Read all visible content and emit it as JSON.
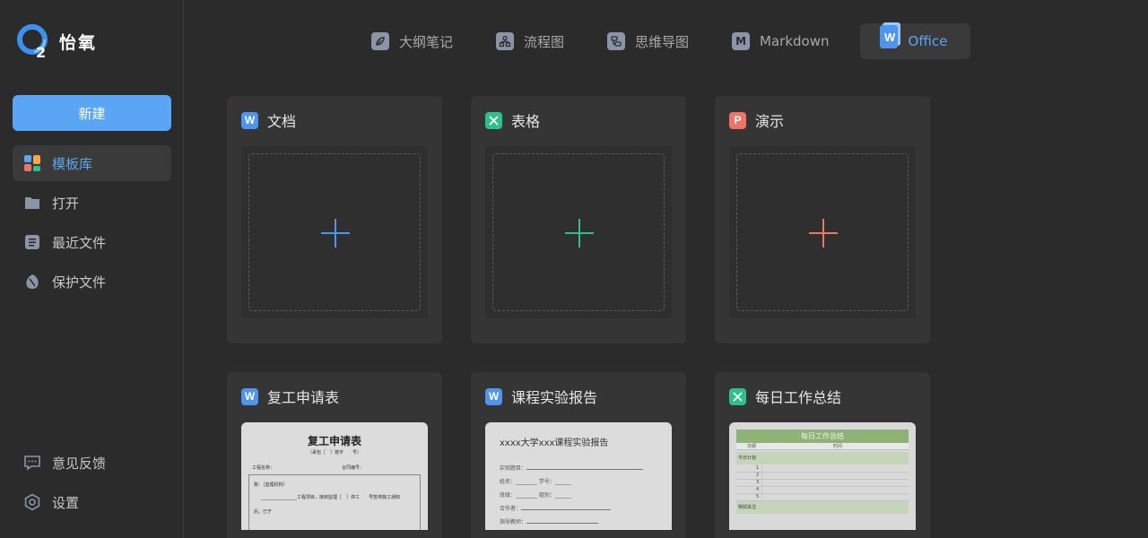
{
  "app": {
    "name": "怡氧"
  },
  "sidebar": {
    "new_button": "新建",
    "items": [
      {
        "label": "模板库",
        "icon": "template-library-icon",
        "active": true
      },
      {
        "label": "打开",
        "icon": "folder-icon",
        "active": false
      },
      {
        "label": "最近文件",
        "icon": "recent-file-icon",
        "active": false
      },
      {
        "label": "保护文件",
        "icon": "protect-icon",
        "active": false
      }
    ],
    "bottom_items": [
      {
        "label": "意见反馈",
        "icon": "feedback-icon"
      },
      {
        "label": "设置",
        "icon": "settings-icon"
      }
    ]
  },
  "tabs": [
    {
      "label": "大纲笔记",
      "icon": "outline-note-icon",
      "active": false
    },
    {
      "label": "流程图",
      "icon": "flowchart-icon",
      "active": false
    },
    {
      "label": "思维导图",
      "icon": "mindmap-icon",
      "active": false
    },
    {
      "label": "Markdown",
      "icon": "markdown-icon",
      "active": false
    },
    {
      "label": "Office",
      "icon": "office-icon",
      "active": true
    }
  ],
  "new_cards": [
    {
      "title": "文档",
      "badge": "W",
      "type": "doc",
      "color": "#4f95ee"
    },
    {
      "title": "表格",
      "badge": "X",
      "type": "sheet",
      "color": "#2fbf8f"
    },
    {
      "title": "演示",
      "badge": "P",
      "type": "ppt",
      "color": "#f07367"
    }
  ],
  "templates": [
    {
      "title": "复工申请表",
      "badge": "W",
      "preview": {
        "heading": "复工申请表",
        "sub": "（承包［　］按字　　号）",
        "field_left": "工程名称：",
        "field_right": "合同编号：",
        "line1": "致：［监理机构］",
        "line2": "________________工程项目，接到监理［　］停工　　号暂停施工通知",
        "line3": "后，已于"
      }
    },
    {
      "title": "课程实验报告",
      "badge": "W",
      "preview": {
        "heading": "xxxx大学xxx课程实验报告",
        "lines": [
          "实验题目：",
          "姓名：________ 学号：______",
          "班级：________ 组别：______",
          "合作者：",
          "指导教师："
        ]
      }
    },
    {
      "title": "每日工作总结",
      "badge": "X",
      "preview": {
        "heading": "每日工作总结",
        "col_date": "日期",
        "col_time": "时间",
        "section1": "今日计划",
        "rows": [
          "1",
          "2",
          "3",
          "4",
          "5"
        ],
        "section2": "特别关注"
      }
    }
  ]
}
